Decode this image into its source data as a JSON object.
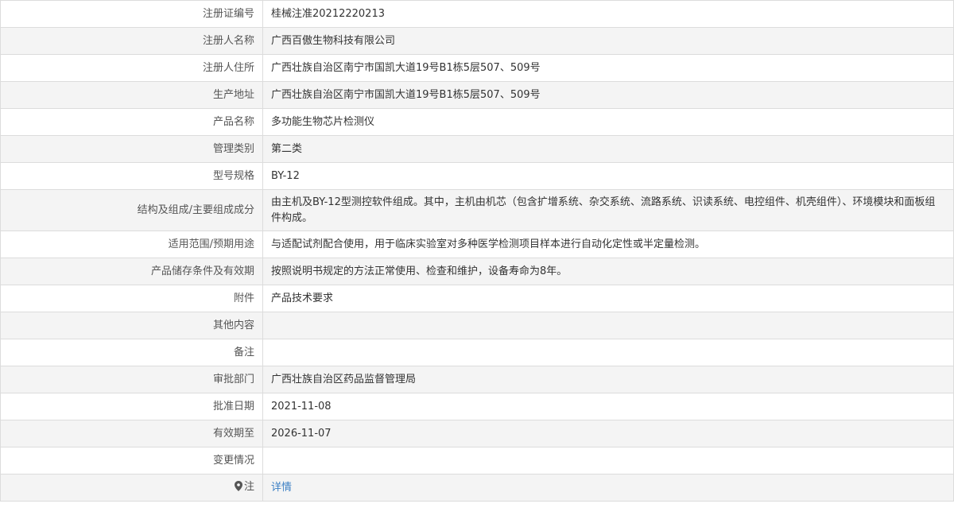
{
  "rows": [
    {
      "label": "注册证编号",
      "value": "桂械注准20212220213"
    },
    {
      "label": "注册人名称",
      "value": "广西百傲生物科技有限公司"
    },
    {
      "label": "注册人住所",
      "value": "广西壮族自治区南宁市国凯大道19号B1栋5层507、509号"
    },
    {
      "label": "生产地址",
      "value": "广西壮族自治区南宁市国凯大道19号B1栋5层507、509号"
    },
    {
      "label": "产品名称",
      "value": "多功能生物芯片检测仪"
    },
    {
      "label": "管理类别",
      "value": "第二类"
    },
    {
      "label": "型号规格",
      "value": "BY-12"
    },
    {
      "label": "结构及组成/主要组成成分",
      "value": "由主机及BY-12型测控软件组成。其中，主机由机芯（包含扩增系统、杂交系统、流路系统、识读系统、电控组件、机壳组件）、环境模块和面板组件构成。"
    },
    {
      "label": "适用范围/预期用途",
      "value": "与适配试剂配合使用，用于临床实验室对多种医学检测项目样本进行自动化定性或半定量检测。"
    },
    {
      "label": "产品储存条件及有效期",
      "value": "按照说明书规定的方法正常使用、检查和维护，设备寿命为8年。"
    },
    {
      "label": "附件",
      "value": "产品技术要求"
    },
    {
      "label": "其他内容",
      "value": ""
    },
    {
      "label": "备注",
      "value": ""
    },
    {
      "label": "审批部门",
      "value": "广西壮族自治区药品监督管理局"
    },
    {
      "label": "批准日期",
      "value": "2021-11-08"
    },
    {
      "label": "有效期至",
      "value": "2026-11-07"
    },
    {
      "label": "变更情况",
      "value": ""
    }
  ],
  "note": {
    "label": "注",
    "icon": "map-pin-icon",
    "link_text": "详情"
  }
}
